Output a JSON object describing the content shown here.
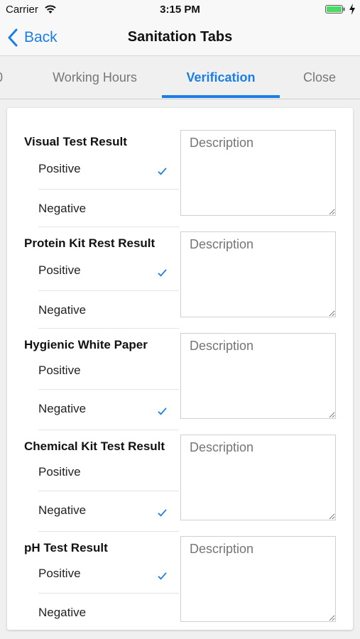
{
  "status_bar": {
    "carrier": "Carrier",
    "time": "3:15 PM"
  },
  "nav": {
    "back_label": "Back",
    "title": "Sanitation Tabs"
  },
  "tabs": {
    "partial_label": "0",
    "items": [
      {
        "label": "Working Hours",
        "active": false
      },
      {
        "label": "Verification",
        "active": true
      },
      {
        "label": "Close",
        "active": false
      }
    ]
  },
  "accent_color": "#1a7ee6",
  "sections": [
    {
      "title": "Visual Test Result",
      "options": [
        {
          "label": "Positive",
          "checked": true
        },
        {
          "label": "Negative",
          "checked": false
        }
      ],
      "description_placeholder": "Description"
    },
    {
      "title": "Protein Kit Rest Result",
      "options": [
        {
          "label": "Positive",
          "checked": true
        },
        {
          "label": "Negative",
          "checked": false
        }
      ],
      "description_placeholder": "Description"
    },
    {
      "title": "Hygienic White Paper",
      "options": [
        {
          "label": "Positive",
          "checked": false
        },
        {
          "label": "Negative",
          "checked": true
        }
      ],
      "description_placeholder": "Description"
    },
    {
      "title": "Chemical Kit Test Result",
      "options": [
        {
          "label": "Positive",
          "checked": false
        },
        {
          "label": "Negative",
          "checked": true
        }
      ],
      "description_placeholder": "Description"
    },
    {
      "title": "pH Test Result",
      "options": [
        {
          "label": "Positive",
          "checked": true
        },
        {
          "label": "Negative",
          "checked": false
        }
      ],
      "description_placeholder": "Description"
    }
  ]
}
